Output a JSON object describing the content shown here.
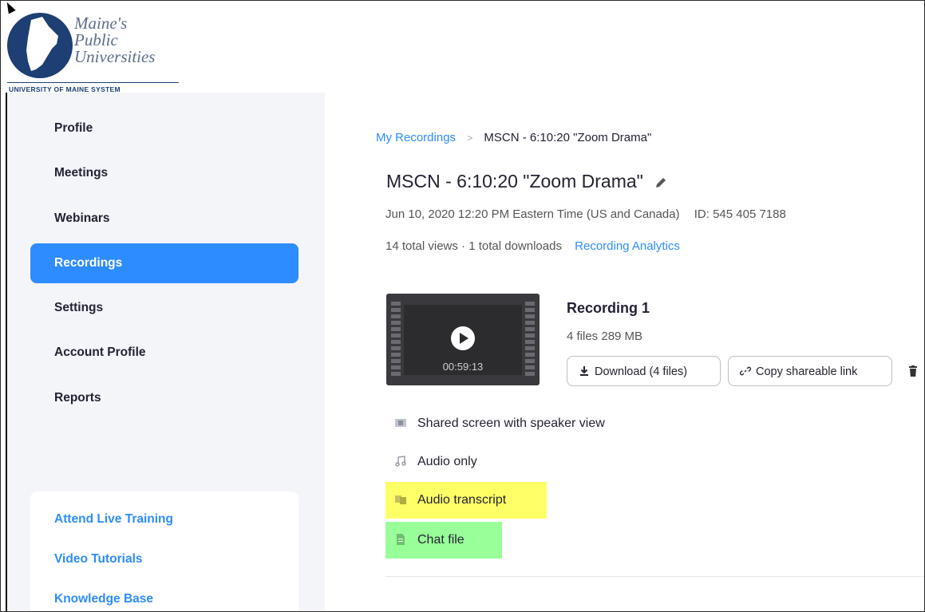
{
  "logo": {
    "line1": "Maine's",
    "line2": "Public",
    "line3": "Universities",
    "system": "UNIVERSITY OF MAINE SYSTEM"
  },
  "sidebar": {
    "items": [
      {
        "label": "Profile",
        "active": false
      },
      {
        "label": "Meetings",
        "active": false
      },
      {
        "label": "Webinars",
        "active": false
      },
      {
        "label": "Recordings",
        "active": true
      },
      {
        "label": "Settings",
        "active": false
      },
      {
        "label": "Account Profile",
        "active": false
      },
      {
        "label": "Reports",
        "active": false
      }
    ],
    "help_links": [
      "Attend Live Training",
      "Video Tutorials",
      "Knowledge Base"
    ]
  },
  "breadcrumb": {
    "root": "My Recordings",
    "separator": ">",
    "current": "MSCN - 6:10:20 \"Zoom Drama\""
  },
  "recording": {
    "title": "MSCN - 6:10:20 \"Zoom Drama\"",
    "datetime": "Jun 10, 2020 12:20 PM Eastern Time (US and Canada)",
    "meeting_id": "ID: 545 405 7188",
    "stats": "14 total views · 1 total downloads",
    "analytics_link": "Recording Analytics",
    "item_title": "Recording 1",
    "file_info": "4 files  289 MB",
    "duration": "00:59:13",
    "download_label": "Download (4 files)",
    "copy_link_label": "Copy shareable link",
    "files": [
      {
        "label": "Shared screen with speaker view",
        "icon": "video-file-icon",
        "highlight": ""
      },
      {
        "label": "Audio only",
        "icon": "music-note-icon",
        "highlight": ""
      },
      {
        "label": "Audio transcript",
        "icon": "transcript-icon",
        "highlight": "#ffff66"
      },
      {
        "label": "Chat file",
        "icon": "document-icon",
        "highlight": "#99ff99"
      }
    ]
  },
  "colors": {
    "accent": "#2d8cff",
    "sidebar_bg": "#f4f5f8",
    "highlight_yellow": "#ffff66",
    "highlight_green": "#99ff99"
  }
}
